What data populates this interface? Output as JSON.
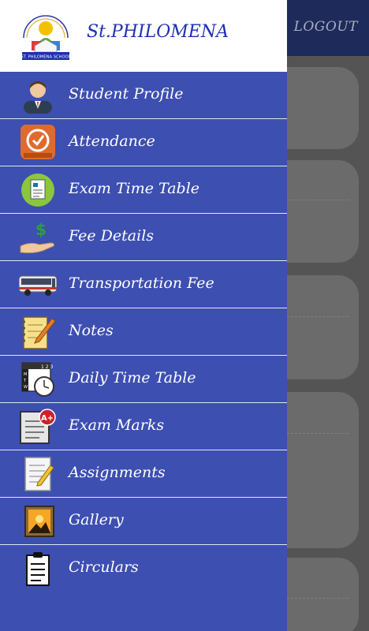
{
  "header": {
    "logout_label": "LOGOUT"
  },
  "drawer": {
    "school_name": "St.PHILOMENA",
    "logo_text": "ST. PHILOMENA SCHOOL",
    "items": [
      {
        "label": "Student Profile",
        "icon": "student-icon"
      },
      {
        "label": "Attendance",
        "icon": "attendance-icon"
      },
      {
        "label": "Exam Time Table",
        "icon": "exam-timetable-icon"
      },
      {
        "label": "Fee Details",
        "icon": "fee-icon"
      },
      {
        "label": "Transportation Fee",
        "icon": "bus-icon"
      },
      {
        "label": "Notes",
        "icon": "notes-icon"
      },
      {
        "label": "Daily Time Table",
        "icon": "calendar-clock-icon"
      },
      {
        "label": "Exam Marks",
        "icon": "exam-marks-icon"
      },
      {
        "label": "Assignments",
        "icon": "assignment-icon"
      },
      {
        "label": "Gallery",
        "icon": "gallery-icon"
      },
      {
        "label": "Circulars",
        "icon": "clipboard-icon"
      }
    ]
  },
  "colors": {
    "drawer_bg": "#3d4fb1",
    "title_blue": "#1d2fb0",
    "topbar": "#1e2a5a"
  }
}
